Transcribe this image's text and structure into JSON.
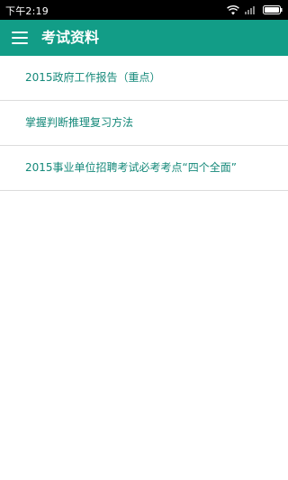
{
  "status_bar": {
    "time": "下午2:19",
    "icons": [
      "wifi-icon",
      "signal-icon",
      "battery-icon"
    ]
  },
  "toolbar": {
    "menu_icon": "hamburger-menu-icon",
    "title": "考试资料",
    "background_color": "#129d87"
  },
  "list": {
    "items": [
      {
        "label": "2015政府工作报告（重点）"
      },
      {
        "label": "掌握判断推理复习方法"
      },
      {
        "label": "2015事业单位招聘考试必考考点“四个全面”"
      }
    ],
    "text_color": "#15897a"
  }
}
